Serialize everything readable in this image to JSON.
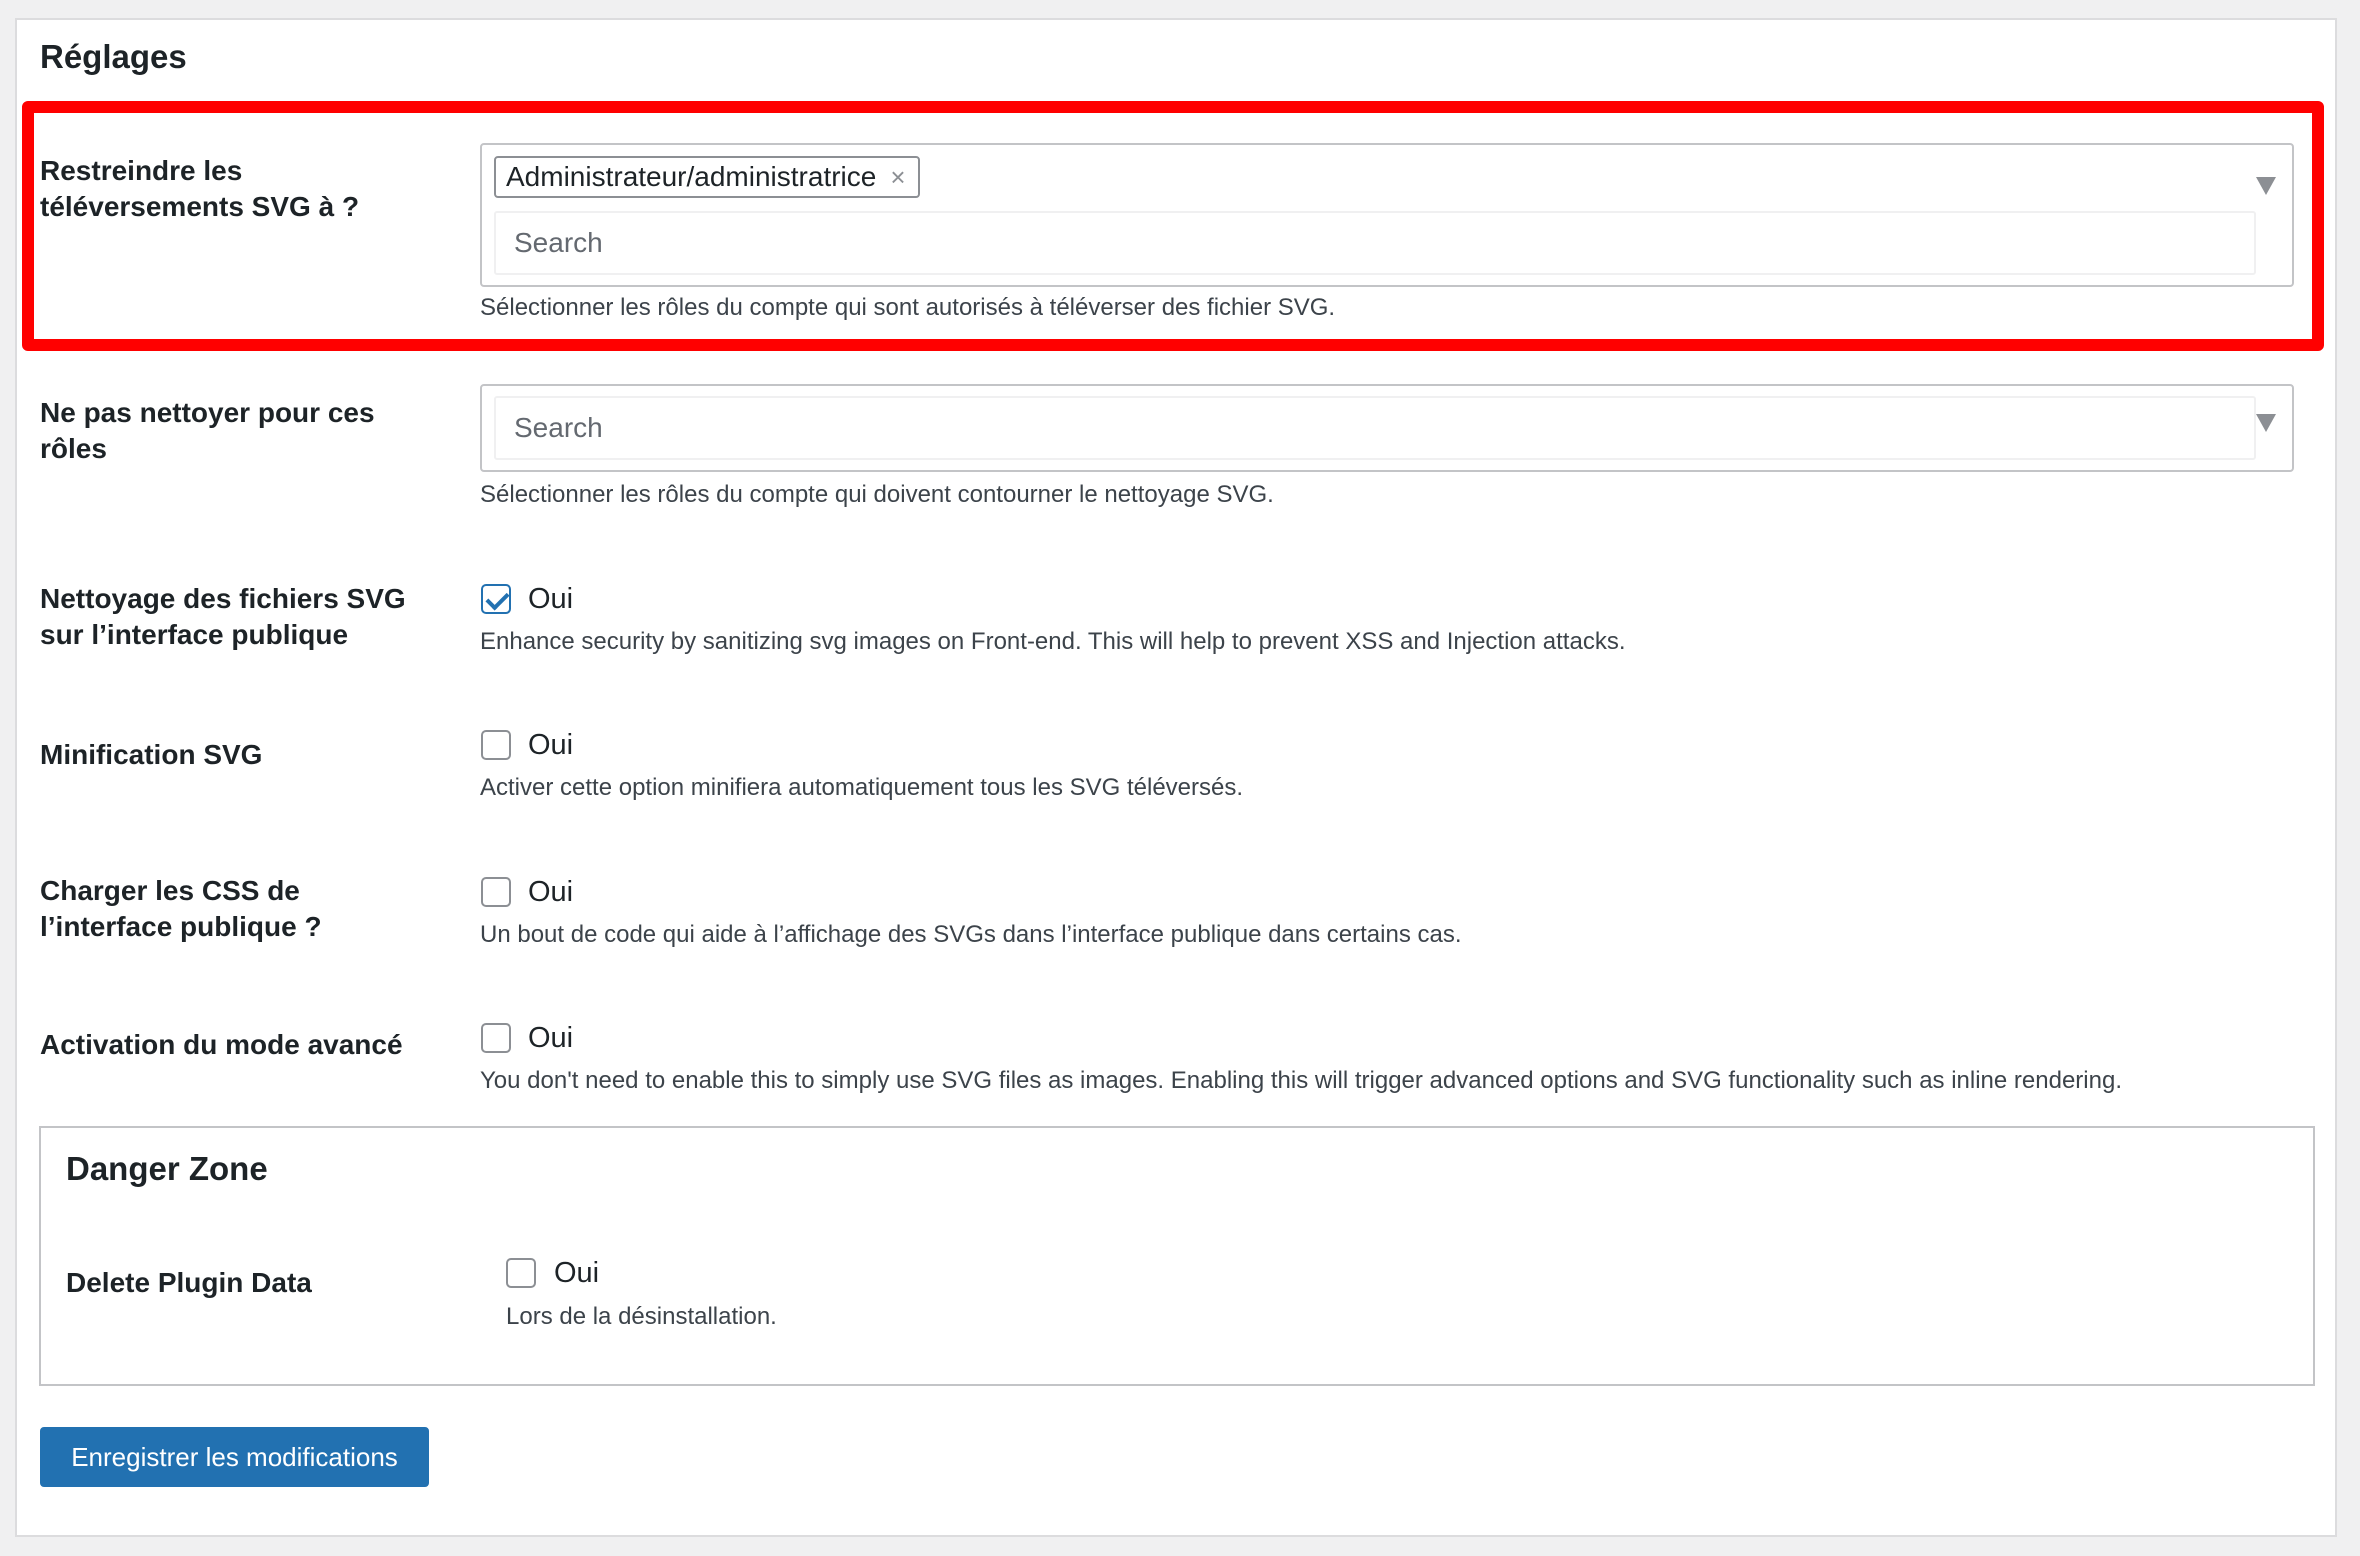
{
  "page": {
    "title": "Réglages"
  },
  "restrict_uploads": {
    "label_line1": "Restreindre les",
    "label_line2": "téléversements SVG à ?",
    "selected_role": "Administrateur/administratrice",
    "remove_glyph": "×",
    "search_placeholder": "Search",
    "description": "Sélectionner les rôles du compte qui sont autorisés à téléverser des fichier SVG."
  },
  "no_sanitize": {
    "label_line1": "Ne pas nettoyer pour ces",
    "label_line2": "rôles",
    "search_placeholder": "Search",
    "description": "Sélectionner les rôles du compte qui doivent contourner le nettoyage SVG."
  },
  "frontend_sanitize": {
    "label_line1": "Nettoyage des fichiers SVG",
    "label_line2": "sur l’interface publique",
    "checkbox_label": "Oui",
    "checked": true,
    "description": "Enhance security by sanitizing svg images on Front-end. This will help to prevent XSS and Injection attacks."
  },
  "minify": {
    "label": "Minification SVG",
    "checkbox_label": "Oui",
    "checked": false,
    "description": "Activer cette option minifiera automatiquement tous les SVG téléversés."
  },
  "frontend_css": {
    "label_line1": "Charger les CSS de",
    "label_line2": "l’interface publique ?",
    "checkbox_label": "Oui",
    "checked": false,
    "description": "Un bout de code qui aide à l’affichage des SVGs dans l’interface publique dans certains cas."
  },
  "advanced_mode": {
    "label": "Activation du mode avancé",
    "checkbox_label": "Oui",
    "checked": false,
    "description": "You don't need to enable this to simply use SVG files as images. Enabling this will trigger advanced options and SVG functionality such as inline rendering."
  },
  "danger_zone": {
    "title": "Danger Zone",
    "delete_label": "Delete Plugin Data",
    "checkbox_label": "Oui",
    "checked": false,
    "description": "Lors de la désinstallation."
  },
  "save_button": {
    "label": "Enregistrer les modifications"
  },
  "colors": {
    "accent": "#2271b1",
    "highlight": "#ff0000",
    "background": "#f0f0f1"
  }
}
